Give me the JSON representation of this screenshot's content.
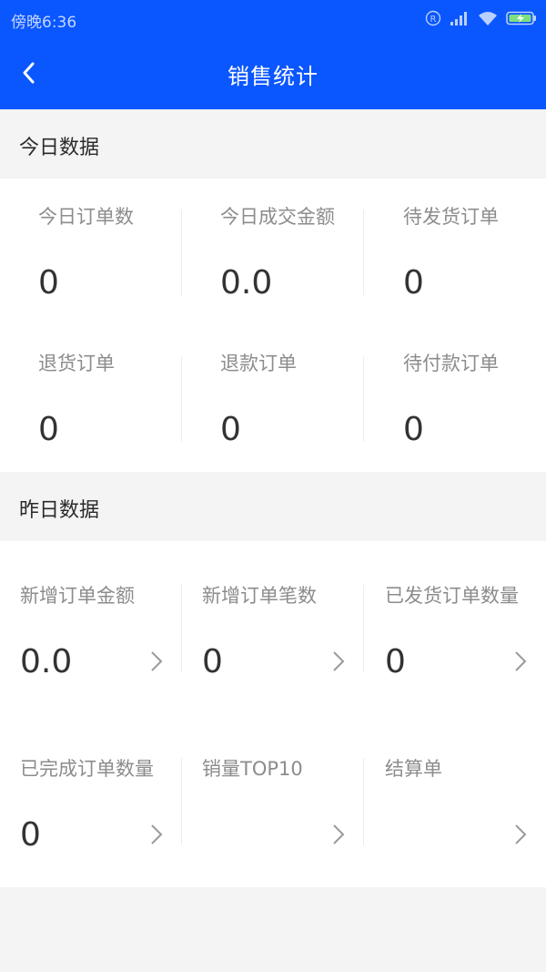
{
  "status_bar": {
    "time": "傍晚6:36",
    "registered_mark": "R"
  },
  "nav": {
    "title": "销售统计"
  },
  "today": {
    "title": "今日数据",
    "items": [
      {
        "label": "今日订单数",
        "value": "0"
      },
      {
        "label": "今日成交金额",
        "value": "0.0"
      },
      {
        "label": "待发货订单",
        "value": "0"
      },
      {
        "label": "退货订单",
        "value": "0"
      },
      {
        "label": "退款订单",
        "value": "0"
      },
      {
        "label": "待付款订单",
        "value": "0"
      }
    ]
  },
  "yesterday": {
    "title": "昨日数据",
    "items": [
      {
        "label": "新增订单金额",
        "value": "0.0"
      },
      {
        "label": "新增订单笔数",
        "value": "0"
      },
      {
        "label": "已发货订单数量",
        "value": "0"
      },
      {
        "label": "已完成订单数量",
        "value": "0"
      },
      {
        "label": "销量TOP10",
        "value": ""
      },
      {
        "label": "结算单",
        "value": ""
      }
    ]
  },
  "colors": {
    "primary": "#0a56ff",
    "background": "#f4f4f4",
    "label": "#8c8c8c",
    "value": "#333333"
  }
}
